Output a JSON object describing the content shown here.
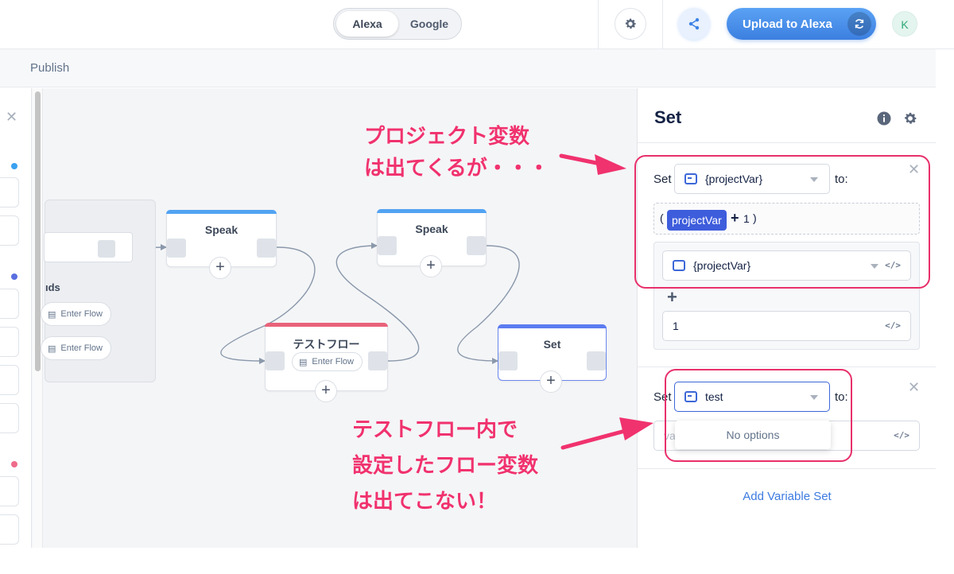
{
  "header": {
    "platforms": [
      "Alexa",
      "Google"
    ],
    "active_platform": "Alexa",
    "upload_label": "Upload to Alexa",
    "avatar_initial": "K"
  },
  "subnav": {
    "publish_label": "Publish"
  },
  "canvas": {
    "group": {
      "label_fragment": "ıds",
      "chip_1": "Enter Flow",
      "chip_2": "Enter Flow"
    },
    "nodes": {
      "speak_1": "Speak",
      "speak_2": "Speak",
      "test_flow": "テストフロー",
      "test_flow_chip": "Enter Flow",
      "set": "Set"
    },
    "colors": {
      "speak_bar": "#52a3f2",
      "flow_bar": "#e9627a",
      "set_bar": "#5b7cf0",
      "dot_blue": "#3aa1f0",
      "dot_indigo": "#5a6fe0",
      "dot_pink": "#ef6b8a"
    }
  },
  "panel": {
    "title": "Set",
    "set_1": {
      "set_label": "Set",
      "variable": "{projectVar}",
      "to_label": "to:",
      "expression": {
        "open": "(",
        "chip": "projectVar",
        "operator": "+",
        "operand": "1",
        "close": ")"
      },
      "operand_variable": "{projectVar}",
      "operand_value": "1",
      "add_operator": "+"
    },
    "set_2": {
      "set_label": "Set",
      "variable": "test",
      "to_label": "to:",
      "dropdown_empty": "No options",
      "value_placeholder_fragment": "va"
    },
    "add_variable_set": "Add Variable Set"
  },
  "annotations": {
    "note_top_line1": "プロジェクト変数",
    "note_top_line2": "は出てくるが・・・",
    "note_bottom_line1": "テストフロー内で",
    "note_bottom_line2": "設定したフロー変数",
    "note_bottom_line3": "は出てこない！",
    "color": "#e8306b"
  }
}
